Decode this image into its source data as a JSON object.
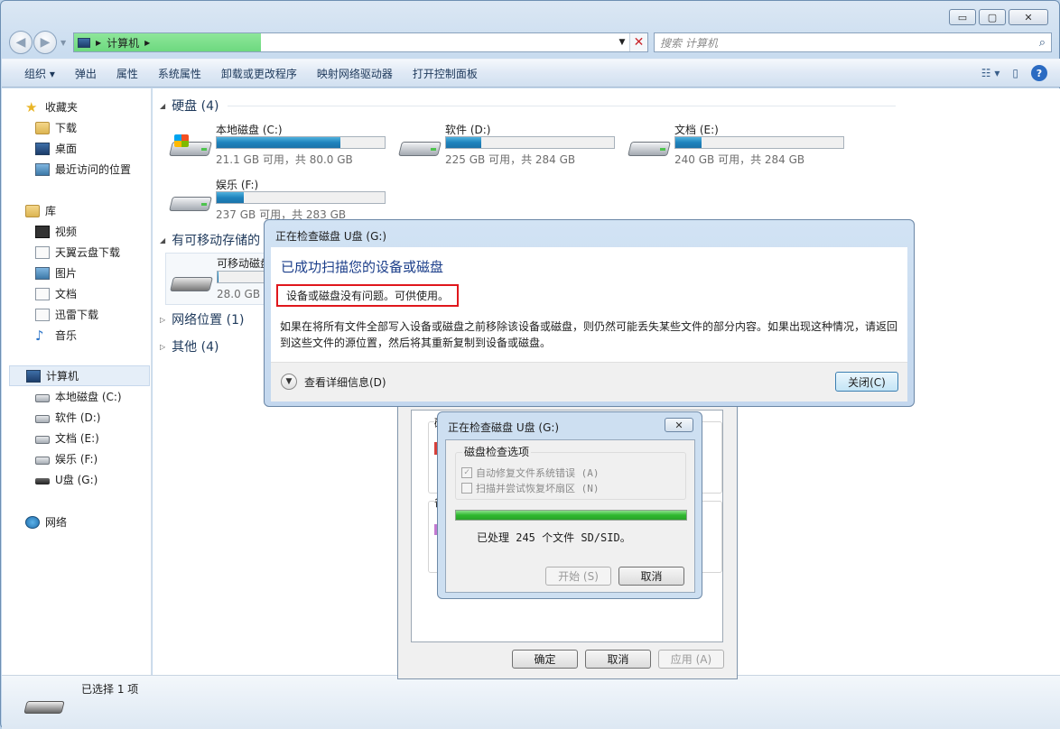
{
  "window": {
    "caption_min": "▭",
    "caption_max": "▢",
    "caption_close": "✕",
    "address_path": [
      "计算机"
    ],
    "search_placeholder": "搜索 计算机"
  },
  "toolbar": {
    "items": [
      "组织 ▾",
      "弹出",
      "属性",
      "系统属性",
      "卸载或更改程序",
      "映射网络驱动器",
      "打开控制面板"
    ]
  },
  "sidebar": {
    "favorites": {
      "label": "收藏夹",
      "items": [
        "下载",
        "桌面",
        "最近访问的位置"
      ]
    },
    "libraries": {
      "label": "库",
      "items": [
        "视频",
        "天翼云盘下载",
        "图片",
        "文档",
        "迅雷下载",
        "音乐"
      ]
    },
    "computer": {
      "label": "计算机",
      "items": [
        "本地磁盘 (C:)",
        "软件 (D:)",
        "文档 (E:)",
        "娱乐 (F:)",
        "U盘 (G:)"
      ]
    },
    "network": {
      "label": "网络"
    }
  },
  "content": {
    "hard_disks": {
      "header": "硬盘 (4)",
      "drives": [
        {
          "name": "本地磁盘 (C:)",
          "free": "21.1 GB 可用，共 80.0 GB",
          "used_fraction": 0.736
        },
        {
          "name": "软件 (D:)",
          "free": "225 GB 可用，共 284 GB",
          "used_fraction": 0.208
        },
        {
          "name": "文档 (E:)",
          "free": "240 GB 可用，共 284 GB",
          "used_fraction": 0.155
        },
        {
          "name": "娱乐 (F:)",
          "free": "237 GB 可用，共 283 GB",
          "used_fraction": 0.163
        }
      ]
    },
    "removable": {
      "header": "有可移动存储的",
      "drive": {
        "name": "可移动磁盘",
        "free": "28.0 GB",
        "used_fraction": 0.01
      }
    },
    "network_header": "网络位置 (1)",
    "other_header": "其他 (4)"
  },
  "status": {
    "text": "已选择 1 项"
  },
  "props_dialog": {
    "ok": "确定",
    "cancel": "取消",
    "apply": "应用 (A)",
    "grp1_letter": "磁",
    "grp2_letter": "备"
  },
  "check_dialog": {
    "title": "正在检查磁盘 U盘 (G:)",
    "close": "✕",
    "group_label": "磁盘检查选项",
    "opt1": "自动修复文件系统错误 (A)",
    "opt2": "扫描并尝试恢复坏扇区 (N)",
    "progress_fraction": 1.0,
    "progress_text": "已处理 245 个文件 SD/SID。",
    "start": "开始 (S)",
    "cancel": "取消"
  },
  "result_dialog": {
    "title": "正在检查磁盘 U盘 (G:)",
    "heading": "已成功扫描您的设备或磁盘",
    "highlight": "设备或磁盘没有问题。可供使用。",
    "description": "如果在将所有文件全部写入设备或磁盘之前移除该设备或磁盘，则仍然可能丢失某些文件的部分内容。如果出现这种情况，请返回到这些文件的源位置，然后将其重新复制到设备或磁盘。",
    "details": "查看详细信息(D)",
    "close": "关闭(C)"
  },
  "colors": {
    "accent_blue": "#1b3e8a",
    "highlight_red": "#e0171c",
    "progress_green": "#2fb82f"
  }
}
